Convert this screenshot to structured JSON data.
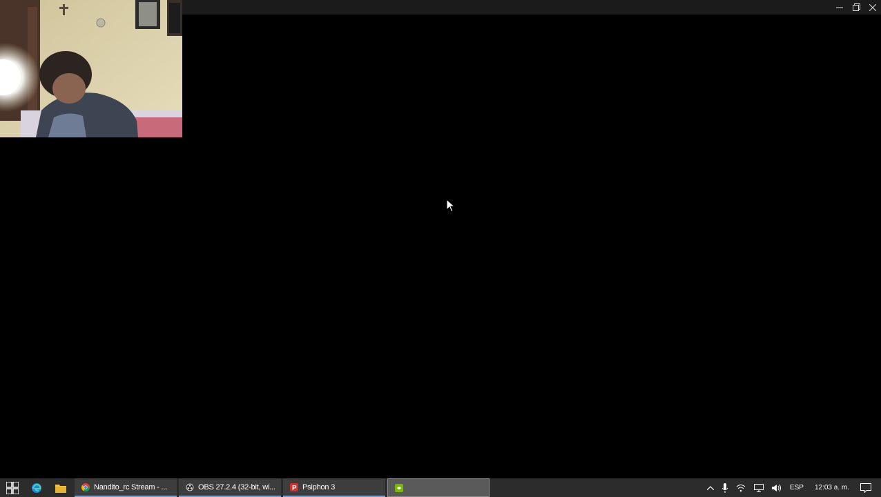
{
  "window": {
    "controls": {
      "minimize_icon": "minimize-icon",
      "restore_icon": "restore-icon",
      "close_icon": "close-icon"
    }
  },
  "webcam": {
    "description_icon": "webcam-feed"
  },
  "taskbar": {
    "start_icon": "windows-start-icon",
    "pinned": [
      {
        "name": "edge",
        "icon": "edge-icon"
      },
      {
        "name": "file-explorer",
        "icon": "folder-icon"
      }
    ],
    "tasks": [
      {
        "label": "Nandito_rc Stream - ...",
        "icon": "chrome-icon"
      },
      {
        "label": "OBS 27.2.4 (32-bit, wi...",
        "icon": "obs-icon"
      },
      {
        "label": "Psiphon 3",
        "icon": "psiphon-icon"
      },
      {
        "label": "",
        "icon": "nvidia-icon"
      }
    ],
    "tray": {
      "show_hidden_icon": "chevron-up-icon",
      "mic_icon": "microphone-icon",
      "network_icon": "network-icon",
      "display_icon": "display-icon",
      "volume_icon": "speaker-icon",
      "language": "ESP",
      "clock": "12:03 a. m.",
      "notifications_icon": "notification-icon"
    }
  },
  "colors": {
    "background": "#000000",
    "taskbar": "#2c2c2c",
    "task_active": "#5a5a5a",
    "titlebar": "#1b1b1b"
  }
}
